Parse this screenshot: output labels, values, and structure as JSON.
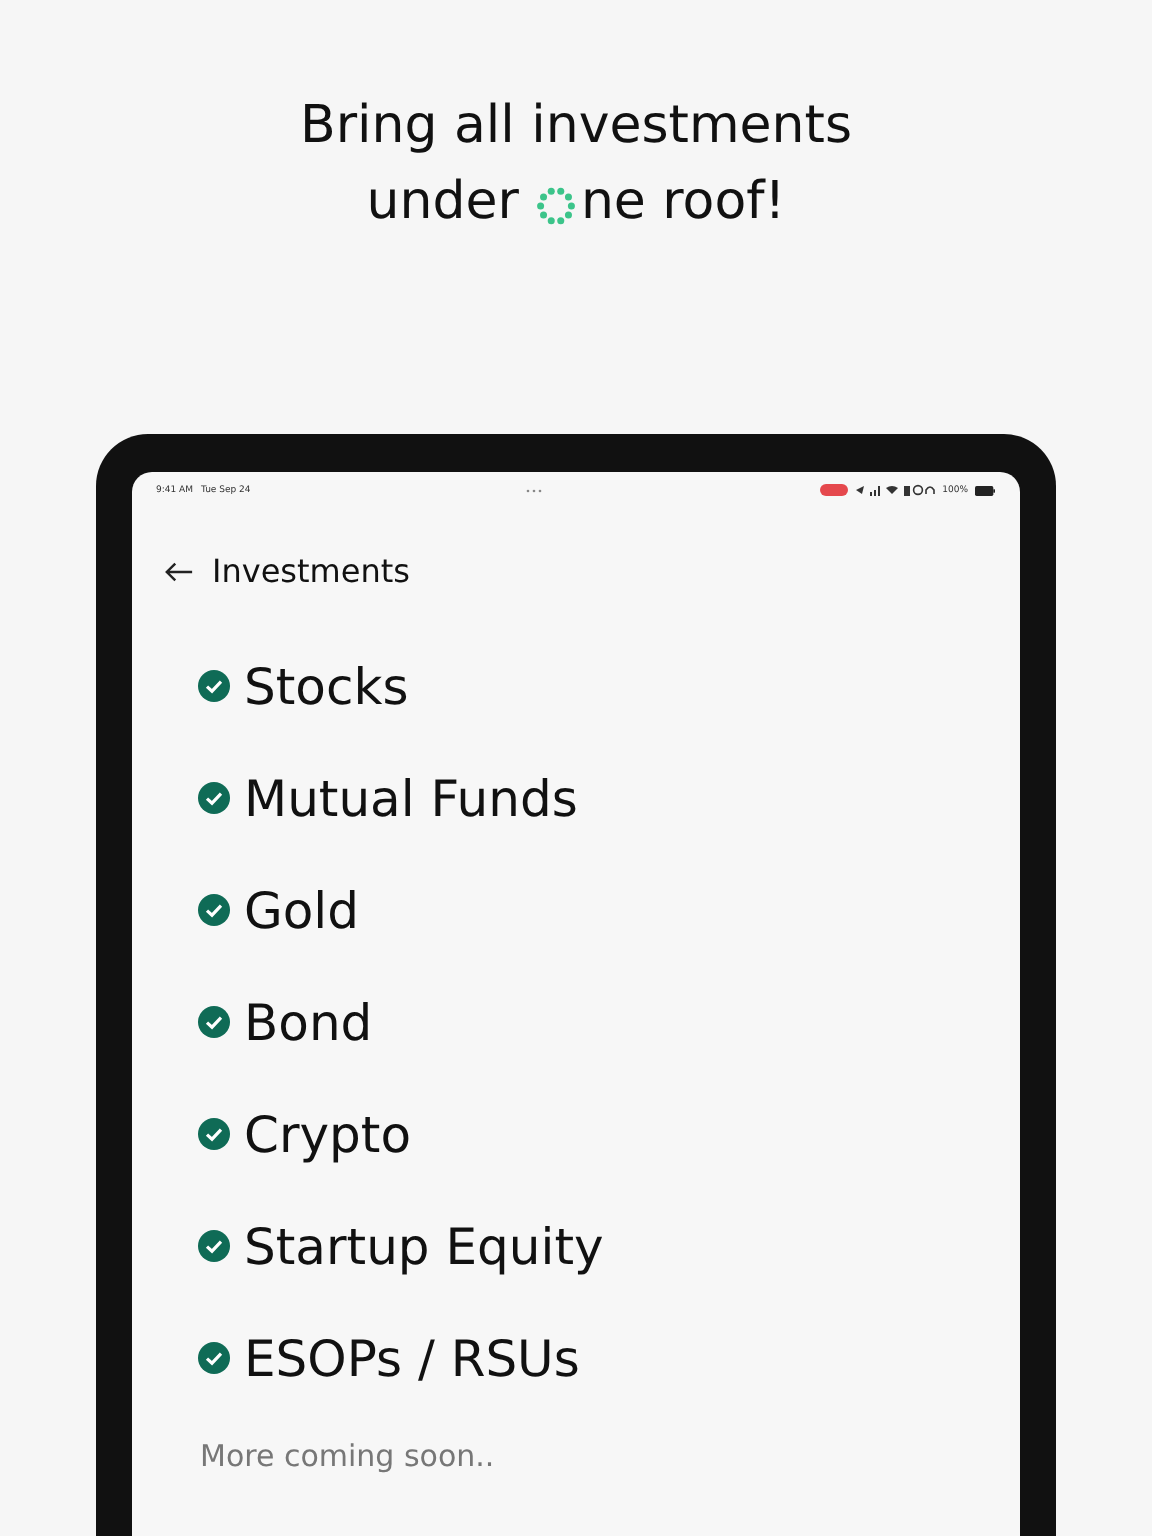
{
  "headline": {
    "line1": "Bring all investments",
    "line2_start": "under",
    "line2_end": "ne roof!"
  },
  "status_bar": {
    "time": "9:41 AM",
    "date": "Tue Sep 24",
    "battery": "100%"
  },
  "header": {
    "title": "Investments"
  },
  "items": [
    {
      "label": "Stocks",
      "checked": true
    },
    {
      "label": "Mutual Funds",
      "checked": true
    },
    {
      "label": "Gold",
      "checked": true
    },
    {
      "label": "Bond",
      "checked": true
    },
    {
      "label": "Crypto",
      "checked": true
    },
    {
      "label": "Startup Equity",
      "checked": true
    },
    {
      "label": "ESOPs / RSUs",
      "checked": true
    }
  ],
  "footer_note": "More coming soon.."
}
